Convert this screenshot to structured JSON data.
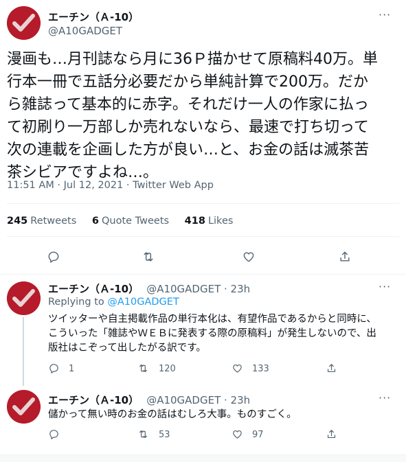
{
  "main_tweet": {
    "display_name": "エーチン（Ａ-10）",
    "handle": "@A10GADGET",
    "text_lines": [
      "漫画も…月刊誌なら月に36Ｐ描かせて原稿料40万。単",
      "行本一冊で五話分必要だから単純計算で200万。だか",
      "ら雑誌って基本的に赤字。それだけ一人の作家に払っ",
      "て初刷り一万部しか売れないなら、最速で打ち切って",
      "次の連載を企画した方が良い…と、お金の話は滅茶苦",
      "茶シビアですよね…。"
    ],
    "timestamp": "11:51 AM · Jul 12, 2021 · Twitter Web App",
    "stats": {
      "retweets_count": "245",
      "retweets_label": "Retweets",
      "quotes_count": "6",
      "quotes_label": "Quote Tweets",
      "likes_count": "418",
      "likes_label": "Likes"
    }
  },
  "replies": [
    {
      "display_name": "エーチン（Ａ-10）",
      "handle_time": "@A10GADGET · 23h",
      "replying_prefix": "Replying to",
      "replying_handle": "@A10GADGET",
      "text_lines": [
        "ツイッターや自主掲載作品の単行本化は、有望作品であるからと同時に、",
        "こういった「雑誌やＷＥＢに発表する際の原稿料」が発生しないので、出",
        "版社はこぞって出したがる訳です。"
      ],
      "reply_count": "1",
      "retweet_count": "120",
      "like_count": "133"
    },
    {
      "display_name": "エーチン（Ａ-10）",
      "handle_time": "@A10GADGET · 23h",
      "text_lines": [
        "儲かって無い時のお金の話はむしろ大事。ものすごく。"
      ],
      "reply_count": "",
      "retweet_count": "53",
      "like_count": "97"
    }
  ],
  "icons": {
    "more": "more-icon",
    "reply": "reply-icon",
    "retweet": "retweet-icon",
    "like": "heart-icon",
    "share": "share-icon"
  },
  "colors": {
    "link": "#1d9bf0",
    "secondary_text": "#536471",
    "avatar_bg": "#b51b2a"
  }
}
